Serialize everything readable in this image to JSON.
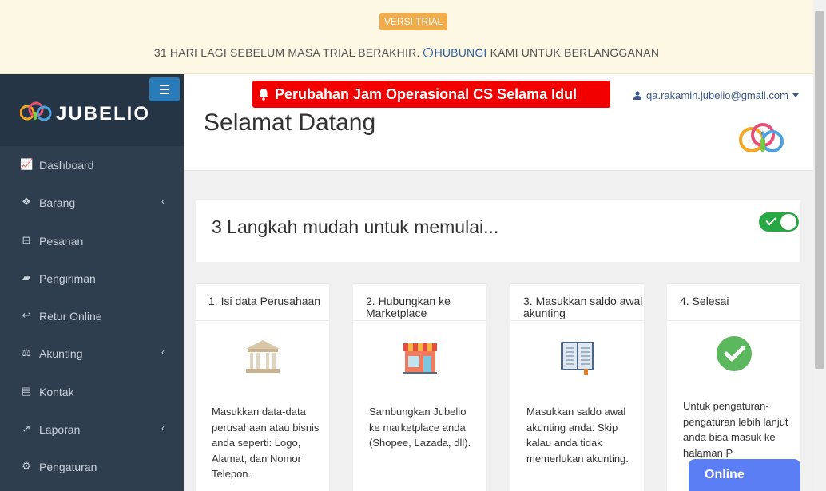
{
  "trial": {
    "badge": "VERSI TRIAL",
    "message_before": "31 HARI LAGI SEBELUM MASA TRIAL BERAKHIR.",
    "link_text": "HUBUNGI",
    "message_after": "KAMI UNTUK BERLANGGANAN"
  },
  "sidebar": {
    "brand": "JUBELIO",
    "items": [
      {
        "label": "Dashboard",
        "icon": "area-chart-icon",
        "glyph": "📈",
        "has_children": false
      },
      {
        "label": "Barang",
        "icon": "cubes-icon",
        "glyph": "❖",
        "has_children": true
      },
      {
        "label": "Pesanan",
        "icon": "basket-icon",
        "glyph": "⊟",
        "has_children": false
      },
      {
        "label": "Pengiriman",
        "icon": "truck-icon",
        "glyph": "▰",
        "has_children": false
      },
      {
        "label": "Retur Online",
        "icon": "reply-icon",
        "glyph": "↩",
        "has_children": false
      },
      {
        "label": "Akunting",
        "icon": "balance-scale-icon",
        "glyph": "⚖",
        "has_children": true
      },
      {
        "label": "Kontak",
        "icon": "address-card-icon",
        "glyph": "▤",
        "has_children": false
      },
      {
        "label": "Laporan",
        "icon": "line-chart-icon",
        "glyph": "↗",
        "has_children": true
      },
      {
        "label": "Pengaturan",
        "icon": "cogs-icon",
        "glyph": "⚙",
        "has_children": false
      }
    ],
    "chevron": "‹"
  },
  "header": {
    "announcement": "Perubahan Jam Operasional CS Selama Idul Adha",
    "user_email": "qa.rakamin.jubelio@gmail.com",
    "page_title": "Selamat Datang"
  },
  "steps": {
    "title": "3 Langkah mudah untuk memulai...",
    "toggle_on": true,
    "cards": [
      {
        "title": "1. Isi data Perusahaan",
        "icon": "bank-building-icon",
        "text": "Masukkan data-data perusahaan atau bisnis anda seperti: Logo, Alamat, dan Nomor Telepon."
      },
      {
        "title": "2. Hubungkan ke Marketplace",
        "icon": "store-icon",
        "text": "Sambungkan Jubelio ke marketplace anda (Shopee, Lazada, dll)."
      },
      {
        "title": "3. Masukkan saldo awal akunting",
        "icon": "ledger-book-icon",
        "text": "Masukkan saldo awal akunting anda. Skip kalau anda tidak memerlukan akunting."
      },
      {
        "title": "4. Selesai",
        "icon": "check-circle-icon",
        "text": "Untuk pengaturan-pengaturan lebih lanjut anda bisa masuk ke halaman P"
      }
    ]
  },
  "chat": {
    "label": "Online"
  },
  "colors": {
    "sidebar_bg": "#2e3e4e",
    "announcement_bg": "#f20000",
    "success": "#28a745",
    "chat": "#5b7ef5",
    "trial_badge": "#f0ad4e"
  }
}
